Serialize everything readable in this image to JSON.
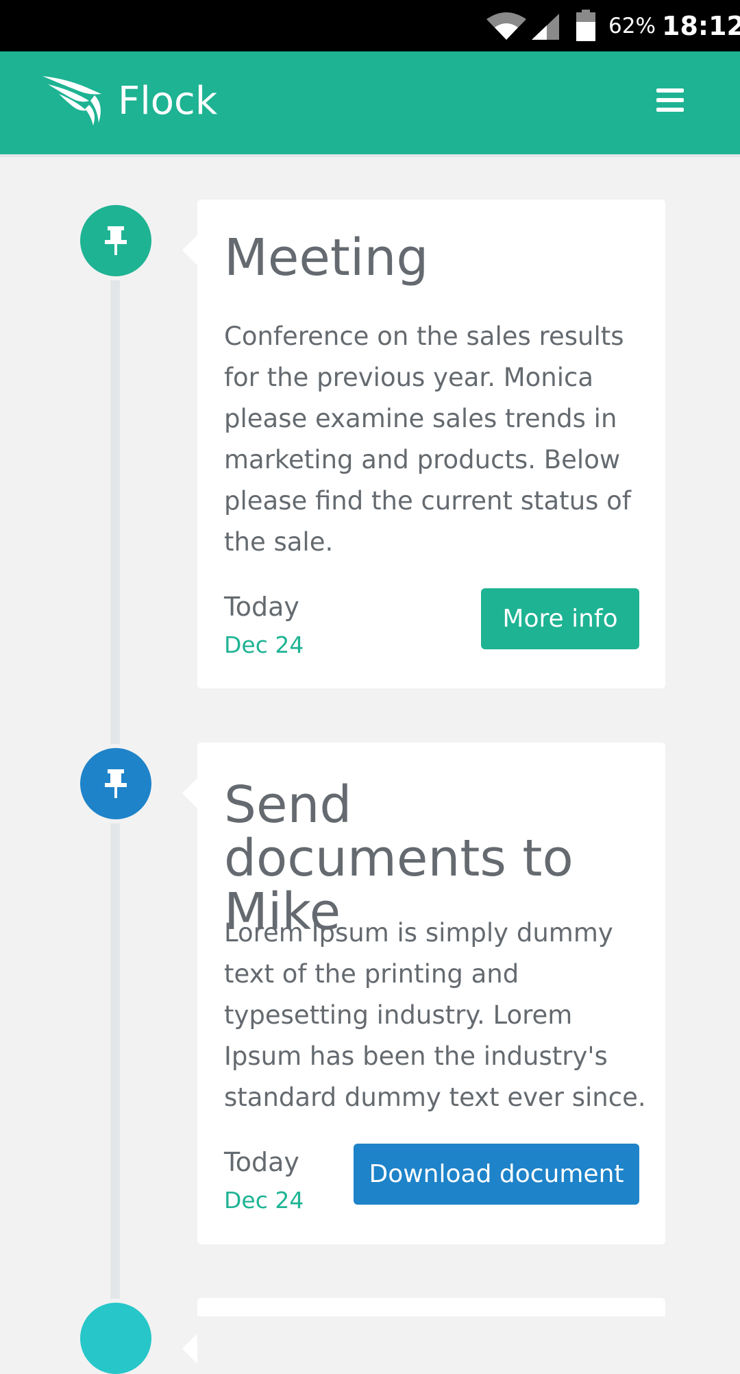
{
  "status_bar": {
    "battery_percent": "62%",
    "time": "18:12",
    "icons": [
      "wifi-icon",
      "signal-icon",
      "battery-icon"
    ]
  },
  "app_bar": {
    "title": "Flock",
    "logo_icon": "wing-logo-icon",
    "menu_icon": "hamburger-menu-icon"
  },
  "timeline": {
    "items": [
      {
        "node_color": "#1eb393",
        "icon": "pushpin-icon",
        "title": "Meeting",
        "body": "Conference on the sales results for the previous year. Monica please examine sales trends in marketing and products. Below please find the current status of the sale.",
        "day": "Today",
        "date": "Dec 24",
        "button_label": "More info",
        "button_color": "#1eb393"
      },
      {
        "node_color": "#1e83c9",
        "icon": "pushpin-icon",
        "title": "Send documents to Mike",
        "body": "Lorem Ipsum is simply dummy text of the printing and typesetting industry. Lorem Ipsum has been the industry's standard dummy text ever since.",
        "day": "Today",
        "date": "Dec 24",
        "button_label": "Download document",
        "button_color": "#1e83c9"
      },
      {
        "node_color": "#26c6c9",
        "icon": "pushpin-icon"
      }
    ]
  }
}
